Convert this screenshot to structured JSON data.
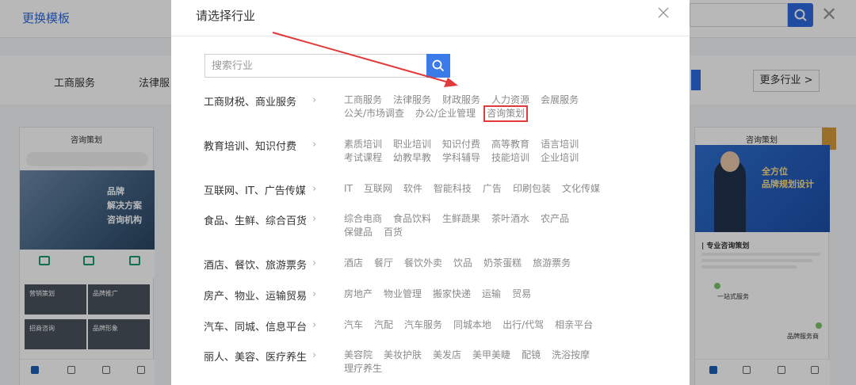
{
  "background": {
    "header": {
      "title": "更换模板"
    },
    "categories": [
      "工商服务",
      "法律服"
    ],
    "more_button": "更多行业 >",
    "card_left": {
      "title": "咨询策划",
      "hero_lines": [
        "品牌",
        "解决方案",
        "咨询机构"
      ],
      "tiles": [
        "营销策划",
        "品牌推广",
        "招商咨询",
        "品牌形象"
      ]
    },
    "card_right": {
      "title": "咨询策划",
      "hero_lines": [
        "全方位",
        "品牌规划设计"
      ],
      "heading": "| 专业咨询策划",
      "box1": "一站式服务",
      "box2": "品牌服务商"
    }
  },
  "modal": {
    "title": "请选择行业",
    "search": {
      "placeholder": "搜索行业"
    },
    "categories": [
      {
        "name": "工商财税、商业服务",
        "items": [
          "工商服务",
          "法律服务",
          "财政服务",
          "人力资源",
          "会展服务",
          "公关/市场调查",
          "办公/企业管理",
          "咨询策划"
        ]
      },
      {
        "name": "教育培训、知识付费",
        "items": [
          "素质培训",
          "职业培训",
          "知识付费",
          "高等教育",
          "语言培训",
          "考试课程",
          "幼教早教",
          "学科辅导",
          "技能培训",
          "企业培训"
        ]
      },
      {
        "name": "互联网、IT、广告传媒",
        "items": [
          "IT",
          "互联网",
          "软件",
          "智能科技",
          "广告",
          "印刷包装",
          "文化传媒"
        ]
      },
      {
        "name": "食品、生鲜、综合百货",
        "items": [
          "综合电商",
          "食品饮料",
          "生鲜蔬果",
          "茶叶酒水",
          "农产品",
          "保健品",
          "百货"
        ]
      },
      {
        "name": "酒店、餐饮、旅游票务",
        "items": [
          "酒店",
          "餐厅",
          "餐饮外卖",
          "饮品",
          "奶茶蛋糕",
          "旅游票务"
        ]
      },
      {
        "name": "房产、物业、运输贸易",
        "items": [
          "房地产",
          "物业管理",
          "搬家快递",
          "运输",
          "贸易"
        ]
      },
      {
        "name": "汽车、同城、信息平台",
        "items": [
          "汽车",
          "汽配",
          "汽车服务",
          "同城本地",
          "出行/代驾",
          "相亲平台"
        ]
      },
      {
        "name": "丽人、美容、医疗养生",
        "items": [
          "美容院",
          "美妆护肤",
          "美发店",
          "美甲美睫",
          "配镜",
          "洗浴按摩",
          "理疗养生"
        ]
      }
    ],
    "highlighted_item": "咨询策划"
  },
  "colors": {
    "accent": "#3a7be8",
    "highlight_box": "#e03a3a",
    "annotation_arrow": "#e03a3a"
  }
}
